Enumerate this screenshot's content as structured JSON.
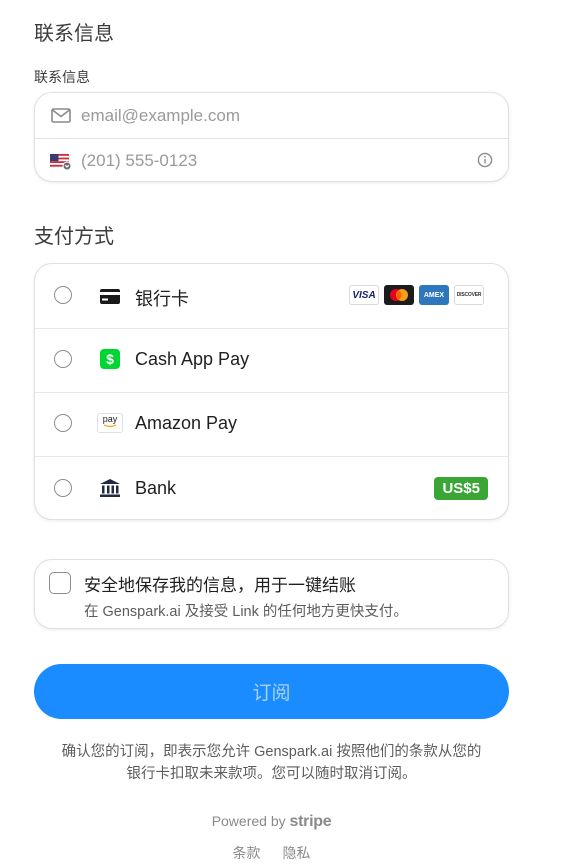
{
  "contact": {
    "heading": "联系信息",
    "field_label": "联系信息",
    "email_placeholder": "email@example.com",
    "phone_placeholder": "(201) 555-0123"
  },
  "payment": {
    "heading": "支付方式",
    "methods": [
      {
        "label": "银行卡",
        "icon": "card-icon",
        "selected": false
      },
      {
        "label": "Cash App Pay",
        "icon": "cash-app-icon",
        "selected": false
      },
      {
        "label": "Amazon Pay",
        "icon": "amazon-pay-icon",
        "selected": false
      },
      {
        "label": "Bank",
        "icon": "bank-icon",
        "selected": false
      }
    ],
    "card_brands": [
      "visa-logo",
      "mastercard-logo",
      "amex-logo",
      "discover-logo"
    ],
    "card_brand_text": {
      "visa": "VISA",
      "amex": "AMEX",
      "discover": "DISCOVER"
    },
    "cash_app_symbol": "$",
    "amazon_pay_text": "pay",
    "bank_badge": "US$5",
    "colors": {
      "bank_badge": "#3aa635",
      "cash_app": "#00d632",
      "visa": "#1a1f71",
      "amex": "#2e77bc"
    }
  },
  "save_info": {
    "checked": false,
    "title": "安全地保存我的信息，用于一键结账",
    "subtitle": "在 Genspark.ai 及接受 Link 的任何地方更快支付。"
  },
  "submit": {
    "label": "订阅",
    "color": "#1a8cff"
  },
  "consent": {
    "line1": "确认您的订阅，即表示您允许 Genspark.ai 按照他们的条款从您的",
    "line2": "银行卡扣取未来款项。您可以随时取消订阅。"
  },
  "footer": {
    "powered_by": "Powered by",
    "brand": "stripe",
    "terms": "条款",
    "privacy": "隐私"
  }
}
